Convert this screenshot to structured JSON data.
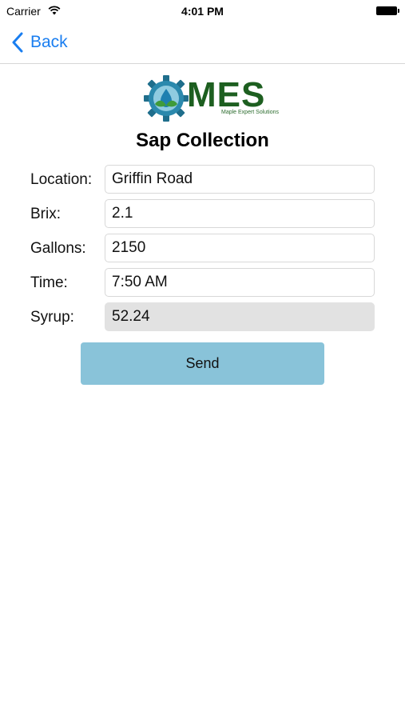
{
  "status_bar": {
    "carrier": "Carrier",
    "time": "4:01 PM"
  },
  "nav": {
    "back_label": "Back"
  },
  "logo": {
    "text": "MES",
    "subtitle": "Maple Expert Solutions"
  },
  "page": {
    "title": "Sap Collection"
  },
  "form": {
    "location": {
      "label": "Location:",
      "value": "Griffin Road"
    },
    "brix": {
      "label": "Brix:",
      "value": "2.1"
    },
    "gallons": {
      "label": "Gallons:",
      "value": "2150"
    },
    "time": {
      "label": "Time:",
      "value": "7:50 AM"
    },
    "syrup": {
      "label": "Syrup:",
      "value": "52.24"
    }
  },
  "actions": {
    "send_label": "Send"
  },
  "colors": {
    "accent": "#1a7ef0",
    "send_button": "#89c3d9",
    "logo_green": "#1d5f20"
  }
}
